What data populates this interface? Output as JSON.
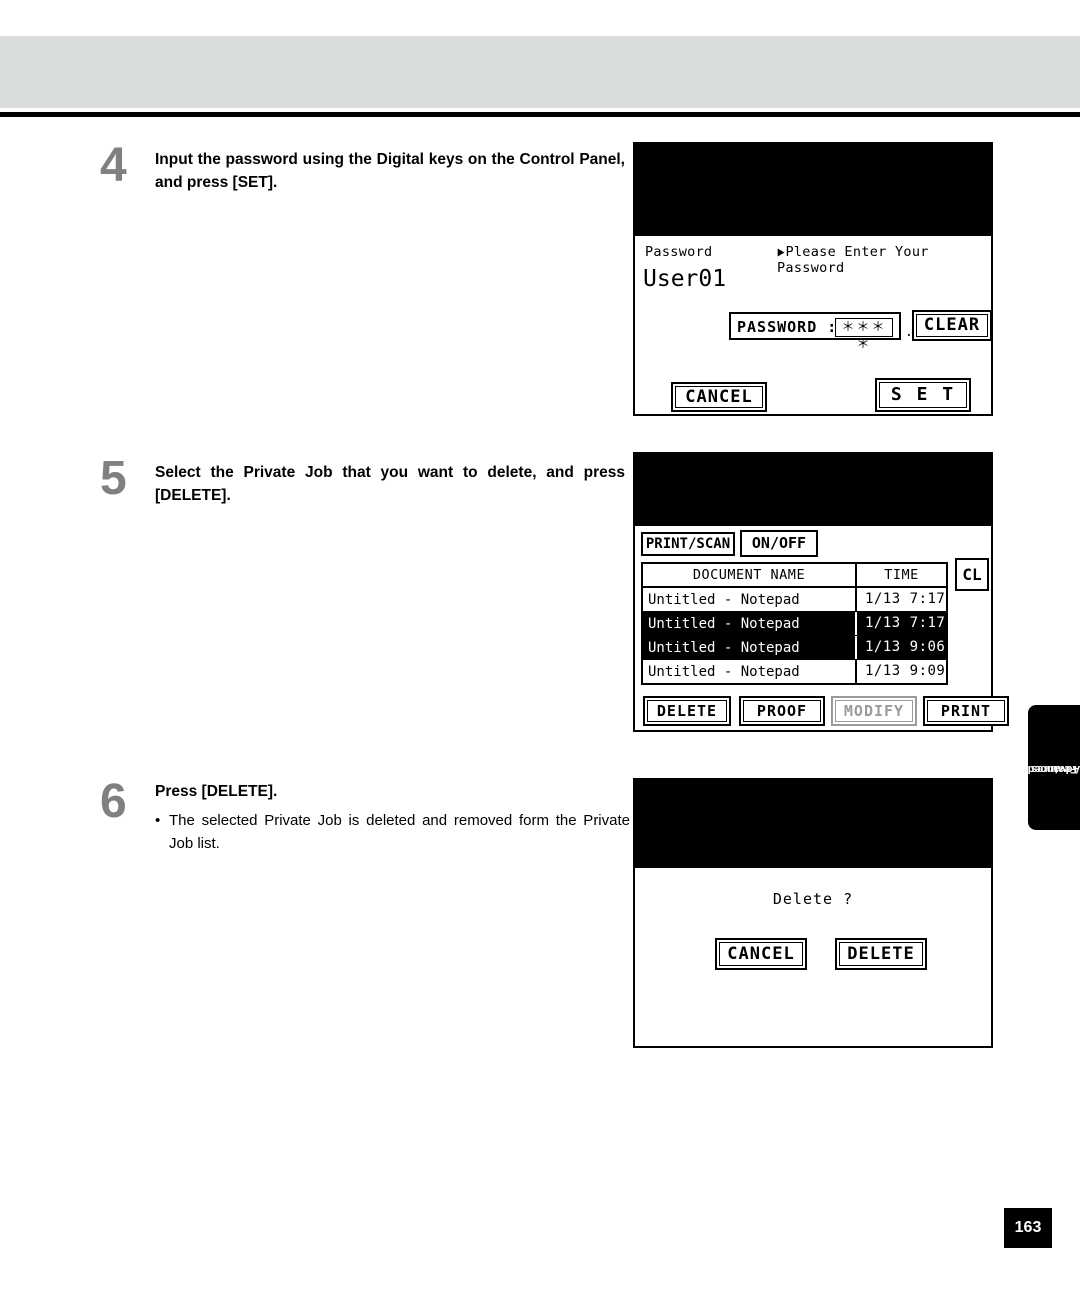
{
  "page": {
    "number": "163",
    "side_tab_line1": "Advanced",
    "side_tab_line2": "Features"
  },
  "steps": [
    {
      "number": "4",
      "text": "Input the password using the Digital keys on the Control Panel, and press [SET]."
    },
    {
      "number": "5",
      "text": "Select the Private Job that you want to delete, and press [DELETE]."
    },
    {
      "number": "6",
      "title": "Press [DELETE].",
      "bullet": "•",
      "body": "The selected Private Job is deleted and removed form the Private Job list."
    }
  ],
  "panel4": {
    "label_password": "Password",
    "prompt_arrow": "▶",
    "prompt": "Please Enter Your Password",
    "user": "User01",
    "password_label": "PASSWORD :",
    "password_value": "＊＊＊＊",
    "dots": "...",
    "clear_button": "CLEAR",
    "cancel_button": "CANCEL",
    "set_button": "S E T"
  },
  "panel5": {
    "print_scan_tab": "PRINT/SCAN",
    "on_off_tab": "ON/OFF",
    "col_document_name": "DOCUMENT NAME",
    "col_time": "TIME",
    "cl_button": "CL",
    "rows": [
      {
        "name": "Untitled - Notepad",
        "time": "1/13  7:17",
        "selected": false
      },
      {
        "name": "Untitled - Notepad",
        "time": "1/13  7:17",
        "selected": true
      },
      {
        "name": "Untitled - Notepad",
        "time": "1/13  9:06",
        "selected": true
      },
      {
        "name": "Untitled - Notepad",
        "time": "1/13  9:09",
        "selected": false
      }
    ],
    "delete_button": "DELETE",
    "proof_button": "PROOF",
    "modify_button": "MODIFY",
    "print_button": "PRINT"
  },
  "panel6": {
    "question": "Delete ?",
    "cancel_button": "CANCEL",
    "delete_button": "DELETE"
  }
}
